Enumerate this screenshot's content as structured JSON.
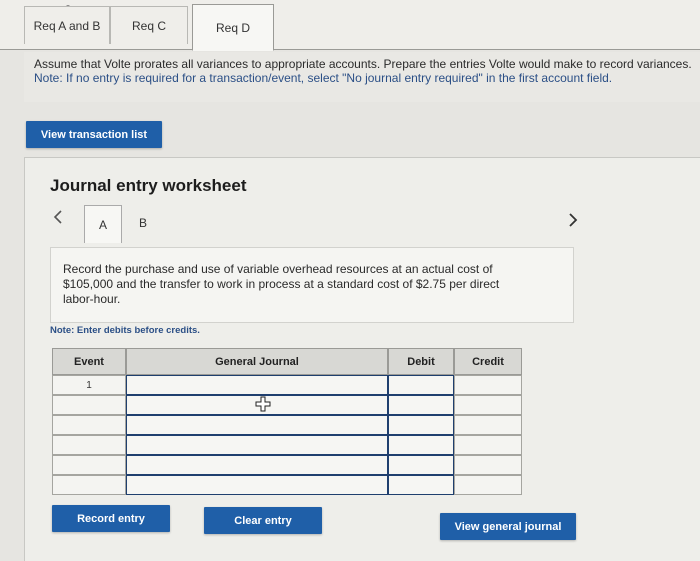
{
  "tabs": [
    {
      "label": "Req A and B"
    },
    {
      "label": "Req C"
    },
    {
      "label": "Req D"
    }
  ],
  "instructions": {
    "text": "Assume that Volte prorates all variances to appropriate accounts. Prepare the entries Volte would make to record variances.",
    "note": "Note: If no entry is required for a transaction/event, select \"No journal entry required\" in the first account field."
  },
  "view_transaction_label": "View transaction list",
  "worksheet": {
    "title": "Journal entry worksheet",
    "prev_icon": "chevron-left-icon",
    "next_icon": "chevron-right-icon",
    "subtabs": [
      {
        "label": "A"
      },
      {
        "label": "B"
      }
    ],
    "description": "Record the purchase and use of variable overhead resources at an actual cost of $105,000 and the transfer to work in process at a standard cost of $2.75 per direct labor-hour.",
    "note": "Note: Enter debits before credits.",
    "columns": {
      "event": "Event",
      "journal": "General Journal",
      "debit": "Debit",
      "credit": "Credit"
    },
    "rows": [
      {
        "event": "1",
        "account": "",
        "debit": "",
        "credit": ""
      },
      {
        "event": "",
        "account": "",
        "debit": "",
        "credit": ""
      },
      {
        "event": "",
        "account": "",
        "debit": "",
        "credit": ""
      },
      {
        "event": "",
        "account": "",
        "debit": "",
        "credit": ""
      },
      {
        "event": "",
        "account": "",
        "debit": "",
        "credit": ""
      },
      {
        "event": "",
        "account": "",
        "debit": "",
        "credit": ""
      }
    ]
  },
  "buttons": {
    "record": "Record entry",
    "clear": "Clear entry",
    "view_journal": "View general journal"
  },
  "colors": {
    "accent": "#1f5fa8",
    "note": "#2b4f86"
  }
}
